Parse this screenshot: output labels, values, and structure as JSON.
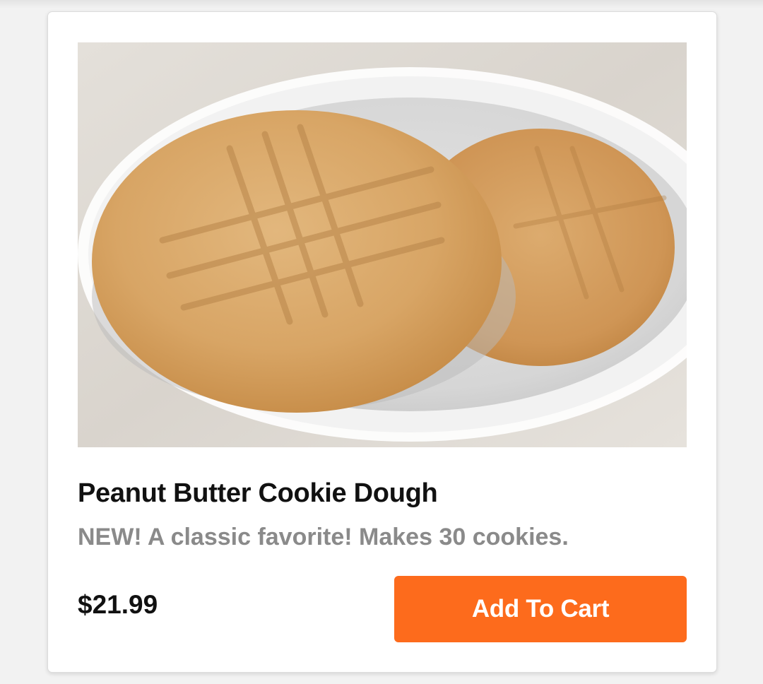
{
  "product": {
    "name": "Peanut Butter Cookie Dough",
    "description": "NEW! A classic favorite! Makes 30 cookies.",
    "price": "$21.99",
    "add_to_cart_label": "Add To Cart",
    "image_subject": "two peanut butter cookies on a white plate"
  },
  "colors": {
    "accent": "#fd6b1c",
    "title_text": "#111111",
    "description_text": "#8a8a8a",
    "card_background": "#ffffff"
  }
}
